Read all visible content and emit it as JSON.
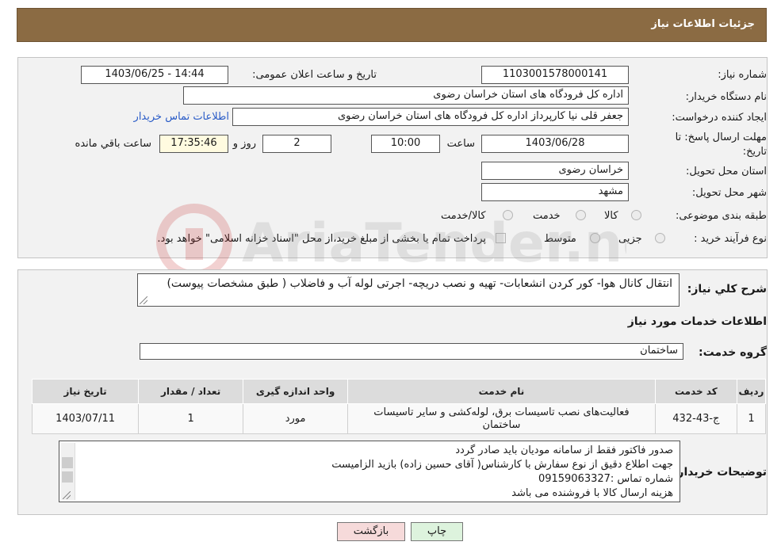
{
  "header": {
    "title": "جزئیات اطلاعات نیاز"
  },
  "form": {
    "need_number_label": "شماره نیاز:",
    "need_number": "1103001578000141",
    "announce_label": "تاریخ و ساعت اعلان عمومی:",
    "announce_value": "1403/06/25 - 14:44",
    "buyer_org_label": "نام دستگاه خریدار:",
    "buyer_org": "اداره کل فرودگاه های استان خراسان رضوی",
    "creator_label": "ایجاد کننده درخواست:",
    "creator": "جعفر قلی نیا کارپرداز اداره کل فرودگاه های استان خراسان رضوی",
    "contact_link": "اطلاعات تماس خریدار",
    "deadline_label": "مهلت ارسال پاسخ: تا تاریخ:",
    "deadline_date": "1403/06/28",
    "time_label": "ساعت",
    "deadline_time": "10:00",
    "days_value": "2",
    "days_label": "روز و",
    "remaining_time": "17:35:46",
    "remaining_label": "ساعت باقي مانده",
    "province_label": "استان محل تحویل:",
    "province": "خراسان رضوی",
    "city_label": "شهر محل تحویل:",
    "city": "مشهد",
    "category_label": "طبقه بندی موضوعی:",
    "category_options": [
      "کالا",
      "خدمت",
      "کالا/خدمت"
    ],
    "process_label": "نوع فرآیند خرید :",
    "process_options": [
      "جزیی",
      "متوسط"
    ],
    "payment_note": "پرداخت تمام یا بخشی از مبلغ خرید،از محل \"اسناد خزانه اسلامی\" خواهد بود."
  },
  "summary": {
    "label": "شرح کلي نياز:",
    "text": "انتقال کانال هوا- کور کردن انشعابات- تهیه و نصب دریچه- اجرتی لوله آب و فاضلاب ( طبق مشخصات پیوست)"
  },
  "services": {
    "section_title": "اطلاعات خدمات مورد نياز",
    "group_label": "گروه خدمت:",
    "group_value": "ساختمان",
    "table": {
      "headers": [
        "رديف",
        "کد خدمت",
        "نام خدمت",
        "واحد اندازه گیری",
        "تعداد / مقدار",
        "تاریخ نیاز"
      ],
      "rows": [
        [
          "1",
          "ج-43-432",
          "فعالیت‌های نصب تاسیسات برق، لوله‌کشی و سایر تاسیسات ساختمان",
          "مورد",
          "1",
          "1403/07/11"
        ]
      ]
    }
  },
  "buyer_notes": {
    "label": "توضیحات خریدار:",
    "lines": [
      "صدور فاکتور فقط از سامانه مودیان باید صادر گردد",
      "جهت اطلاع دقیق از نوع سفارش با کارشناس( آقای حسین زاده) بازید الزامیست",
      "شماره تماس :09159063327",
      "هزینه ارسال کالا با فروشنده می باشد"
    ]
  },
  "buttons": {
    "print": "چاپ",
    "back": "بازگشت"
  },
  "colors": {
    "header_bg": "#8b6b43",
    "link": "#2a5cc7",
    "back_btn_bg": "#f6dada",
    "print_btn_bg": "#ddf3dd"
  }
}
